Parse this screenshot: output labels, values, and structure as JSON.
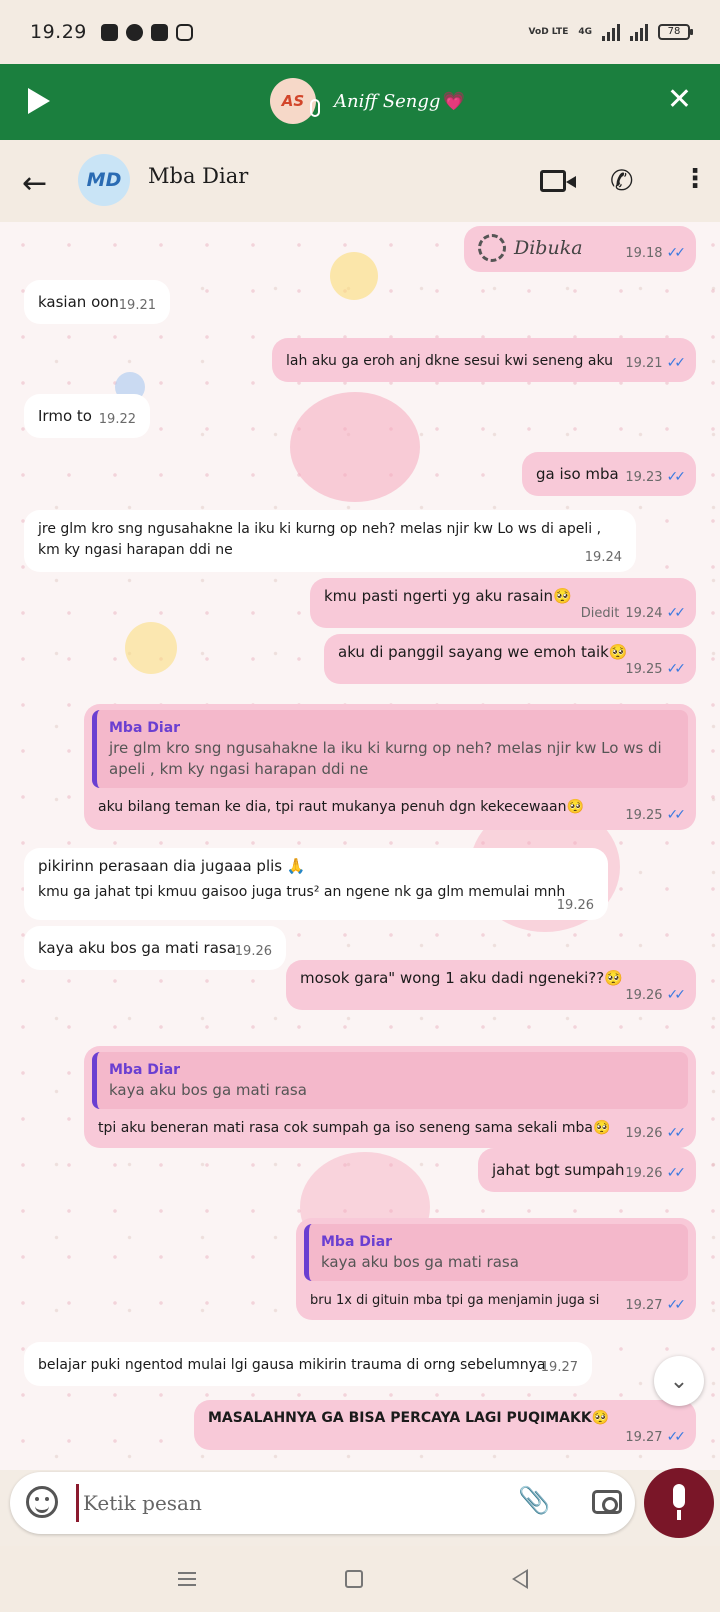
{
  "status": {
    "time": "19.29",
    "net_label": "VoD LTE",
    "net_type": "4G",
    "battery": "78"
  },
  "voice_chat": {
    "avatar_initials": "AS",
    "name": "Aniff Sengg",
    "heart": "💗"
  },
  "header": {
    "avatar_initials": "MD",
    "contact_name": "Mba Diar"
  },
  "messages": [
    {
      "dir": "out",
      "type": "view_once",
      "text": "Dibuka",
      "time": "19.18",
      "ticks": "✓✓"
    },
    {
      "dir": "in",
      "text": "kasian oon",
      "time": "19.21"
    },
    {
      "dir": "out",
      "text": "lah aku ga eroh anj dkne sesui kwi seneng aku",
      "time": "19.21",
      "ticks": "✓✓"
    },
    {
      "dir": "in",
      "text": "Irmo to",
      "time": "19.22"
    },
    {
      "dir": "out",
      "text": "ga iso mba",
      "time": "19.23",
      "ticks": "✓✓"
    },
    {
      "dir": "in",
      "text": "jre glm kro sng ngusahakne la iku ki kurng op neh? melas njir kw Lo ws di apeli , km ky ngasi harapan ddi ne",
      "time": "19.24"
    },
    {
      "dir": "out",
      "text": "kmu pasti ngerti yg aku rasain🥺",
      "edited": "Diedit",
      "time": "19.24",
      "ticks": "✓✓"
    },
    {
      "dir": "out",
      "text": "aku di panggil sayang we emoh taik🥺",
      "time": "19.25",
      "ticks": "✓✓"
    },
    {
      "dir": "out",
      "quote_author": "Mba Diar",
      "quote_text": "jre glm kro sng ngusahakne la iku ki kurng op neh? melas njir kw Lo ws di apeli , km ky ngasi harapan ddi ne",
      "text": "aku bilang teman ke dia, tpi raut mukanya penuh dgn kekecewaan🥺",
      "time": "19.25",
      "ticks": "✓✓"
    },
    {
      "dir": "in",
      "text": "pikirinn perasaan dia jugaaa plis 🙏",
      "text2": "kmu ga jahat tpi kmuu gaisoo juga trus² an ngene nk ga glm memulai mnh",
      "time": "19.26"
    },
    {
      "dir": "in",
      "text": "kaya aku bos ga mati rasa",
      "time": "19.26"
    },
    {
      "dir": "out",
      "text": "mosok gara\" wong 1 aku dadi ngeneki??🥺",
      "time": "19.26",
      "ticks": "✓✓"
    },
    {
      "dir": "out",
      "quote_author": "Mba Diar",
      "quote_text": "kaya aku bos ga mati rasa",
      "text": "tpi aku beneran mati rasa cok sumpah ga iso seneng sama sekali mba🥺",
      "time": "19.26",
      "ticks": "✓✓"
    },
    {
      "dir": "out",
      "text": "jahat bgt sumpah",
      "time": "19.26",
      "ticks": "✓✓"
    },
    {
      "dir": "out",
      "quote_author": "Mba Diar",
      "quote_text": "kaya aku bos ga mati rasa",
      "text": "bru 1x di gituin mba tpi ga menjamin juga si",
      "time": "19.27",
      "ticks": "✓✓"
    },
    {
      "dir": "in",
      "text": "belajar puki ngentod mulai lgi gausa mikirin trauma di orng sebelumnya",
      "time": "19.27"
    },
    {
      "dir": "out",
      "text": "MASALAHNYA GA BISA PERCAYA LAGI PUQIMAKK🥺",
      "time": "19.27",
      "ticks": "✓✓"
    }
  ],
  "input": {
    "placeholder": "Ketik pesan"
  },
  "colors": {
    "voice_bar": "#1b7f3e",
    "outgoing_bubble": "#f8c9d8",
    "incoming_bubble": "#ffffff",
    "quote_accent": "#6a3fd1",
    "read_ticks": "#3b7ae0",
    "mic_button": "#7a1628"
  },
  "icons": [
    "play-icon",
    "close-icon",
    "back-arrow-icon",
    "video-call-icon",
    "phone-icon",
    "more-options-icon",
    "view-once-icon",
    "double-tick-icon",
    "scroll-down-icon",
    "emoji-icon",
    "attach-icon",
    "camera-icon",
    "mic-icon"
  ]
}
